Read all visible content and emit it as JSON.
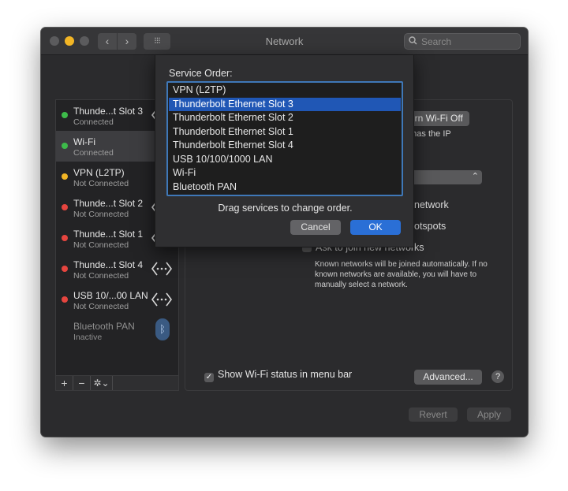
{
  "window": {
    "title": "Network"
  },
  "search": {
    "placeholder": "Search"
  },
  "toolbar": {
    "back_glyph": "‹",
    "forward_glyph": "›",
    "grid_glyph": "⁝⁝⁝"
  },
  "services": [
    {
      "name": "Thunde...t Slot  3",
      "status": "Connected",
      "dot_color": "#3dbb4a",
      "icon": "arrows-icon"
    },
    {
      "name": "Wi-Fi",
      "status": "Connected",
      "dot_color": "#3dbb4a",
      "icon": "wifi-icon",
      "selected": true
    },
    {
      "name": "VPN (L2TP)",
      "status": "Not Connected",
      "dot_color": "#f2b525",
      "icon": "vpn-icon"
    },
    {
      "name": "Thunde...t Slot  2",
      "status": "Not Connected",
      "dot_color": "#e6453f",
      "icon": "arrows-icon"
    },
    {
      "name": "Thunde...t Slot  1",
      "status": "Not Connected",
      "dot_color": "#e6453f",
      "icon": "arrows-icon"
    },
    {
      "name": "Thunde...t Slot  4",
      "status": "Not Connected",
      "dot_color": "#e6453f",
      "icon": "arrows-icon"
    },
    {
      "name": "USB 10/...00 LAN",
      "status": "Not Connected",
      "dot_color": "#e6453f",
      "icon": "arrows-icon"
    },
    {
      "name": "Bluetooth PAN",
      "status": "Inactive",
      "dot_color": "",
      "icon": "bluetooth-icon",
      "inactive": true
    }
  ],
  "list_toolbar": {
    "add": "+",
    "remove": "−",
    "gear": "✲⌄"
  },
  "detail": {
    "wifi_button": "urn Wi-Fi Off",
    "ip_text": "d has the IP",
    "network_text": "network",
    "hotspots_text": "otspots",
    "ask_label": "Ask to join new networks",
    "known_text": "Known networks will be joined automatically. If no known networks are available, you will have to manually select a network.",
    "show_status_label": "Show Wi-Fi status in menu bar",
    "advanced_button": "Advanced...",
    "help_glyph": "?",
    "revert_button": "Revert",
    "apply_button": "Apply"
  },
  "sheet": {
    "title": "Service Order:",
    "items": [
      "VPN (L2TP)",
      "Thunderbolt Ethernet Slot  3",
      "Thunderbolt Ethernet Slot  2",
      "Thunderbolt Ethernet Slot  1",
      "Thunderbolt Ethernet Slot  4",
      "USB 10/100/1000 LAN",
      "Wi-Fi",
      "Bluetooth PAN"
    ],
    "selected_index": 1,
    "hint": "Drag services to change order.",
    "cancel_button": "Cancel",
    "ok_button": "OK"
  },
  "colors": {
    "accent": "#2a6fd6",
    "selection": "#2057b5",
    "focus_ring": "#3f78b8"
  }
}
